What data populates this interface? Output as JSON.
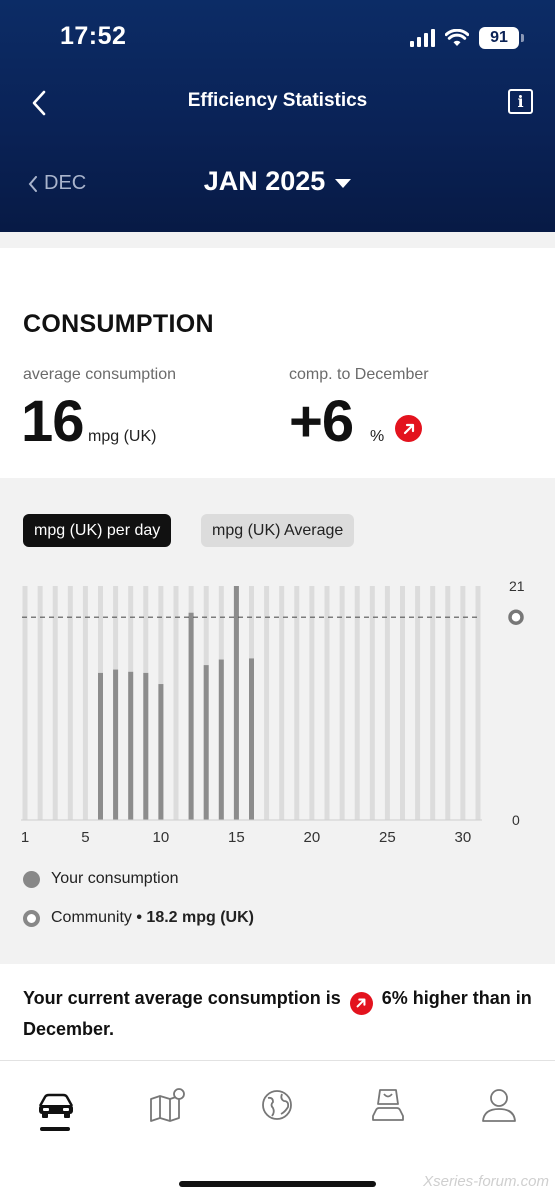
{
  "status_bar": {
    "time": "17:52",
    "battery": "91"
  },
  "header": {
    "title": "Efficiency Statistics",
    "prev_month": "DEC",
    "current_month": "JAN 2025"
  },
  "consumption": {
    "title": "CONSUMPTION",
    "average_label": "average consumption",
    "average_value": "16",
    "average_unit": "mpg (UK)",
    "comparison_label": "comp. to December",
    "comparison_value": "+6",
    "comparison_unit": "%"
  },
  "toggles": {
    "per_day": "mpg (UK) per day",
    "average": "mpg (UK) Average"
  },
  "legend": {
    "your_consumption": "Your consumption",
    "community_label": "Community",
    "community_separator": "•",
    "community_value": "18.2 mpg (UK)"
  },
  "summary": {
    "text_before": "Your current average consumption is",
    "text_after": "6% higher than in December."
  },
  "chart_data": {
    "type": "bar",
    "x_ticks": [
      "1",
      "5",
      "10",
      "15",
      "20",
      "25",
      "30"
    ],
    "y_tick_labels": [
      "21",
      "0"
    ],
    "ylim": [
      0,
      21
    ],
    "days": [
      1,
      2,
      3,
      4,
      5,
      6,
      7,
      8,
      9,
      10,
      11,
      12,
      13,
      14,
      15,
      16,
      17,
      18,
      19,
      20,
      21,
      22,
      23,
      24,
      25,
      26,
      27,
      28,
      29,
      30,
      31
    ],
    "values": [
      null,
      null,
      null,
      null,
      null,
      13.2,
      13.5,
      13.3,
      13.2,
      12.2,
      null,
      18.6,
      13.9,
      14.4,
      21,
      14.5,
      null,
      null,
      null,
      null,
      null,
      null,
      null,
      null,
      null,
      null,
      null,
      null,
      null,
      null,
      null
    ],
    "community_average": 18.2,
    "colors": {
      "bar": "#8c8c8c",
      "placeholder": "#dcdcdc",
      "average_line": "#555555"
    }
  },
  "watermark": "Xseries-forum.com"
}
